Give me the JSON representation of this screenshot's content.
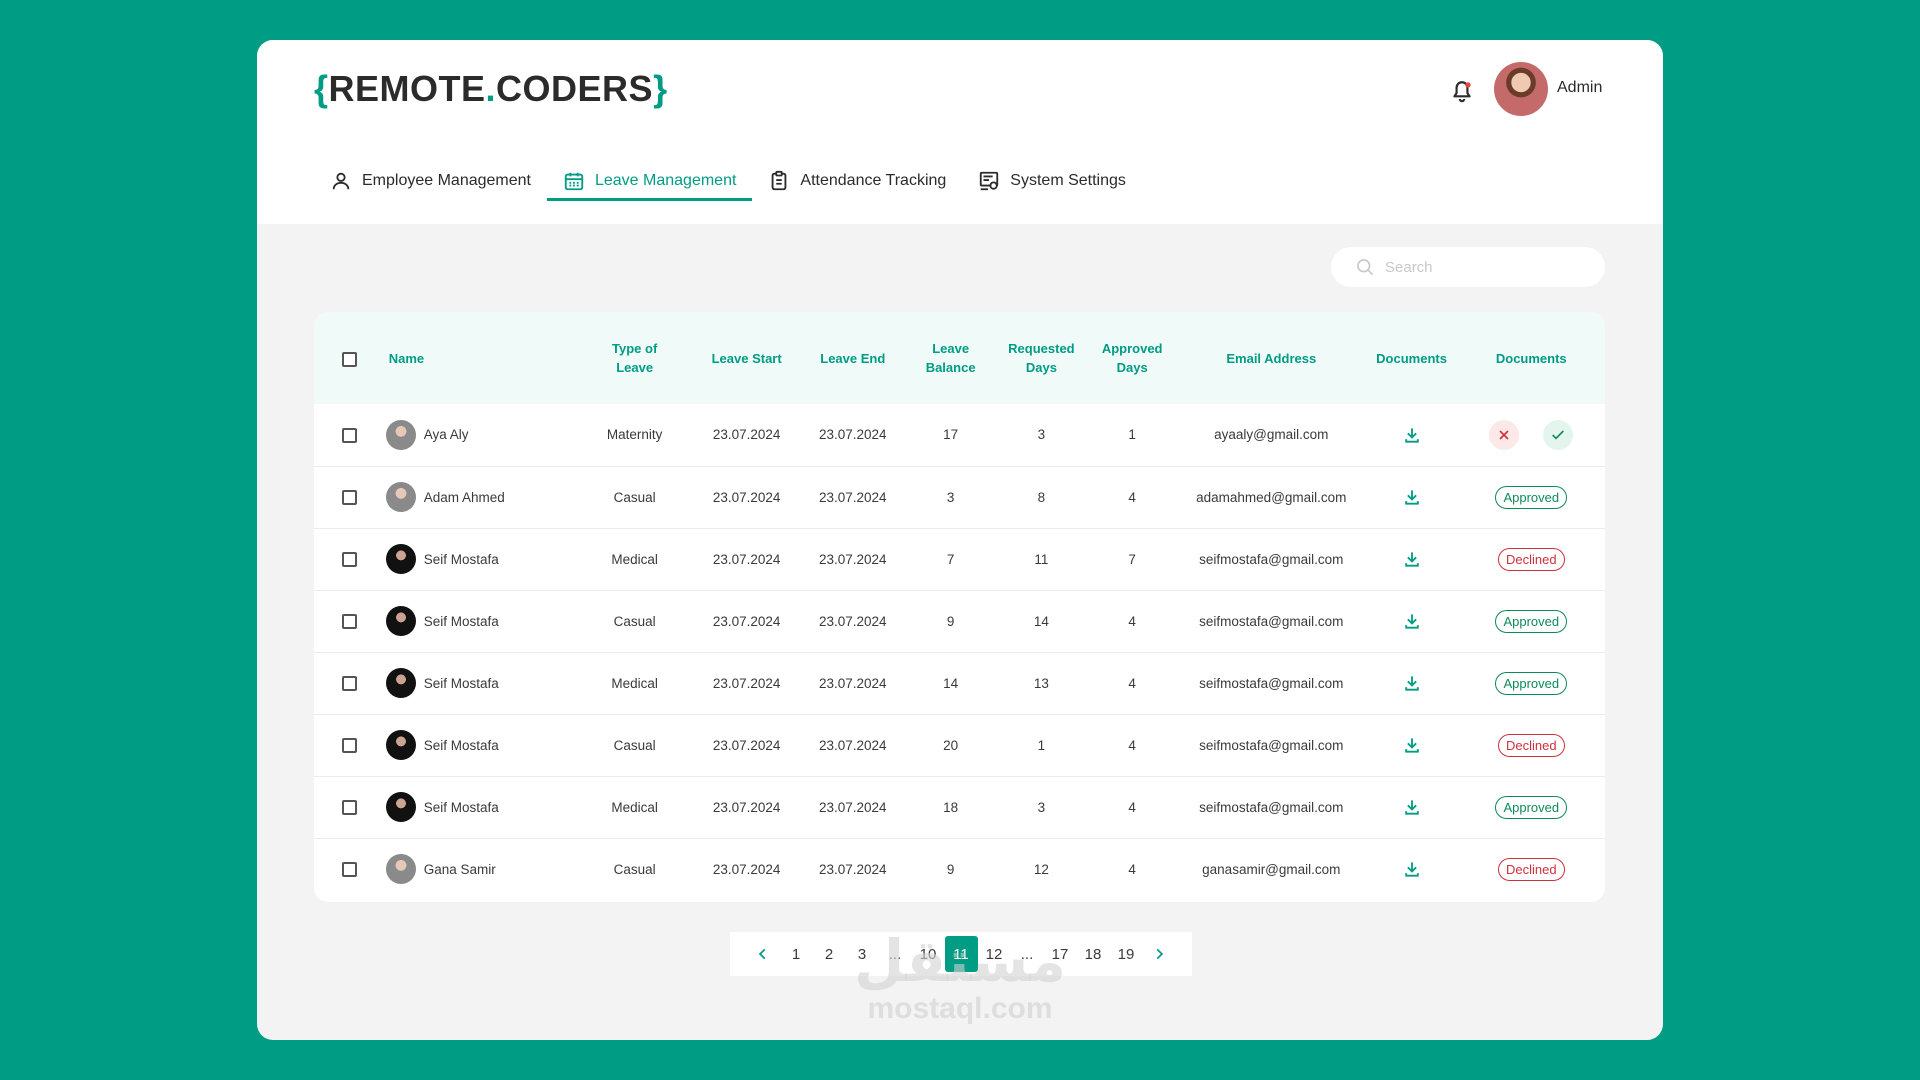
{
  "app": {
    "logo_open": "{",
    "logo_part1": "REMOTE",
    "logo_dot": ".",
    "logo_part2": "CODERS",
    "logo_close": "}",
    "user_name": "Admin",
    "accent": "#009c84"
  },
  "tabs": [
    {
      "label": "Employee Management",
      "icon": "user-icon",
      "active": false
    },
    {
      "label": "Leave Management",
      "icon": "calendar-icon",
      "active": true
    },
    {
      "label": "Attendance Tracking",
      "icon": "clipboard-icon",
      "active": false
    },
    {
      "label": "System Settings",
      "icon": "settings-panel-icon",
      "active": false
    }
  ],
  "search": {
    "placeholder": "Search",
    "value": ""
  },
  "table": {
    "headers": {
      "name": "Name",
      "type_1": "Type of",
      "type_2": "Leave",
      "start": "Leave Start",
      "end": "Leave End",
      "balance_1": "Leave",
      "balance_2": "Balance",
      "requested_1": "Requested",
      "requested_2": "Days",
      "approved_1": "Approved",
      "approved_2": "Days",
      "email": "Email Address",
      "documents": "Documents",
      "documents_status": "Documents"
    },
    "rows": [
      {
        "name": "Aya Aly",
        "type": "Maternity",
        "start": "23.07.2024",
        "end": "23.07.2024",
        "balance": "17",
        "requested": "3",
        "approved": "1",
        "email": "ayaaly@gmail.com",
        "status": "pending",
        "avatar": "g"
      },
      {
        "name": "Adam Ahmed",
        "type": "Casual",
        "start": "23.07.2024",
        "end": "23.07.2024",
        "balance": "3",
        "requested": "8",
        "approved": "4",
        "email": "adamahmed@gmail.com",
        "status": "Approved",
        "avatar": "g"
      },
      {
        "name": "Seif Mostafa",
        "type": "Medical",
        "start": "23.07.2024",
        "end": "23.07.2024",
        "balance": "7",
        "requested": "11",
        "approved": "7",
        "email": "seifmostafa@gmail.com",
        "status": "Declined",
        "avatar": "d"
      },
      {
        "name": "Seif Mostafa",
        "type": "Casual",
        "start": "23.07.2024",
        "end": "23.07.2024",
        "balance": "9",
        "requested": "14",
        "approved": "4",
        "email": "seifmostafa@gmail.com",
        "status": "Approved",
        "avatar": "d"
      },
      {
        "name": "Seif Mostafa",
        "type": "Medical",
        "start": "23.07.2024",
        "end": "23.07.2024",
        "balance": "14",
        "requested": "13",
        "approved": "4",
        "email": "seifmostafa@gmail.com",
        "status": "Approved",
        "avatar": "d"
      },
      {
        "name": "Seif Mostafa",
        "type": "Casual",
        "start": "23.07.2024",
        "end": "23.07.2024",
        "balance": "20",
        "requested": "1",
        "approved": "4",
        "email": "seifmostafa@gmail.com",
        "status": "Declined",
        "avatar": "d"
      },
      {
        "name": "Seif Mostafa",
        "type": "Medical",
        "start": "23.07.2024",
        "end": "23.07.2024",
        "balance": "18",
        "requested": "3",
        "approved": "4",
        "email": "seifmostafa@gmail.com",
        "status": "Approved",
        "avatar": "d"
      },
      {
        "name": "Gana Samir",
        "type": "Casual",
        "start": "23.07.2024",
        "end": "23.07.2024",
        "balance": "9",
        "requested": "12",
        "approved": "4",
        "email": "ganasamir@gmail.com",
        "status": "Declined",
        "avatar": "g"
      }
    ]
  },
  "pagination": {
    "pages": [
      "1",
      "2",
      "3",
      "...",
      "10",
      "11",
      "12",
      "...",
      "17",
      "18",
      "19"
    ],
    "current": "11"
  },
  "watermark": {
    "arabic": "مستقل",
    "latin": "mostaql.com"
  }
}
